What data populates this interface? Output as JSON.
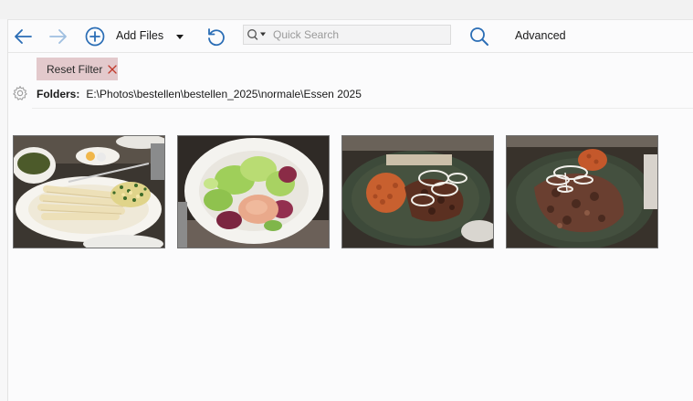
{
  "toolbar": {
    "back_icon": "arrow-left-icon",
    "forward_icon": "arrow-right-icon",
    "add_icon": "plus-circle-icon",
    "add_files_label": "Add Files",
    "dropdown_icon": "caret-down-icon",
    "refresh_icon": "undo-icon",
    "search_placeholder": "Quick Search",
    "search_icon": "magnifier-icon",
    "advanced_label": "Advanced",
    "accent_color": "#2a6db5"
  },
  "filter": {
    "reset_label": "Reset Filter",
    "close_icon": "close-icon",
    "chip_color": "#e3c9cc",
    "close_color": "#c0392b"
  },
  "folders": {
    "label": "Folders:",
    "path": "E:\\Photos\\bestellen\\bestellen_2025\\normale\\Essen 2025",
    "settings_icon": "gear-icon"
  },
  "thumbnails": [
    {
      "subject": "white asparagus with sauce, chopped egg and herbs"
    },
    {
      "subject": "green and radicchio salad with dressing in white bowl"
    },
    {
      "subject": "grilled meat platter with onion rings and rice"
    },
    {
      "subject": "sliced gyros meat with onions and rice on dark plate"
    }
  ]
}
